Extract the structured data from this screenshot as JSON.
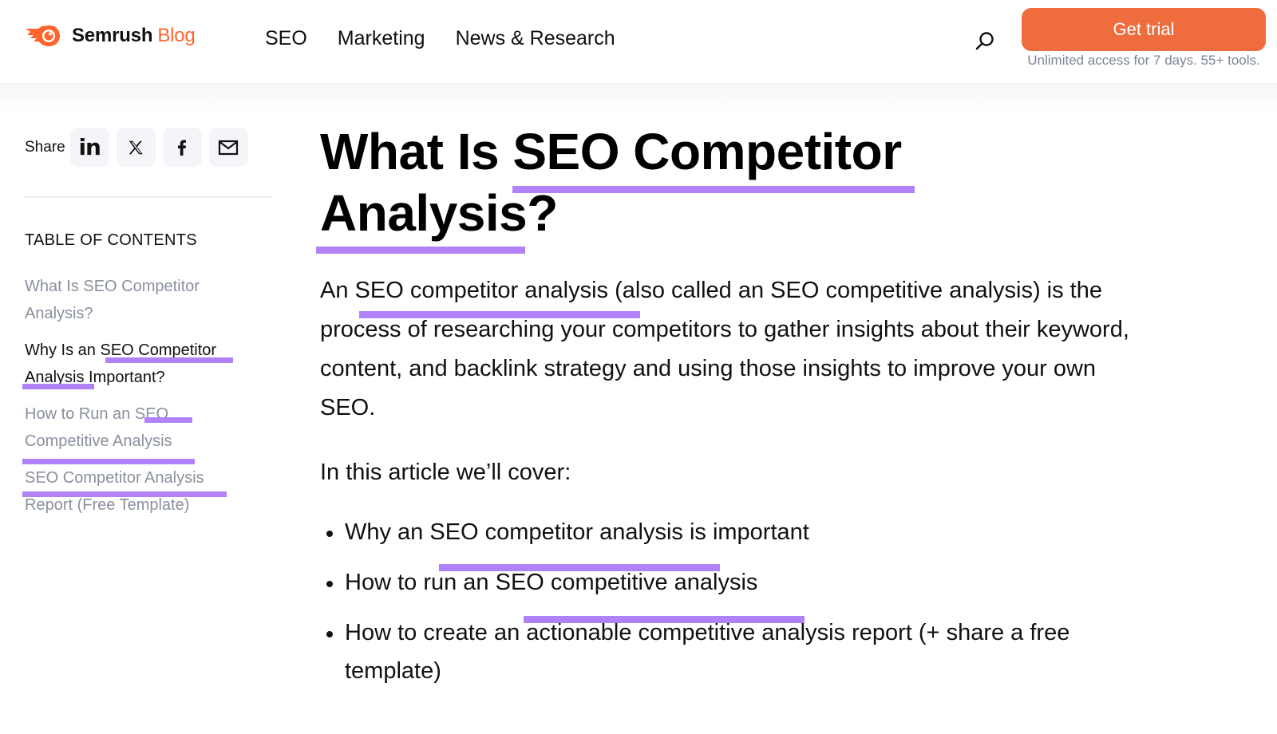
{
  "header": {
    "brand": "Semrush",
    "brand_suffix": "Blog",
    "brand_color": "#ff642d",
    "nav": [
      {
        "label": "SEO"
      },
      {
        "label": "Marketing"
      },
      {
        "label": "News & Research"
      }
    ],
    "search_icon": "search-icon",
    "cta_label": "Get trial",
    "cta_color": "#ee6c3e",
    "cta_subtext": "Unlimited access for 7 days. 55+ tools."
  },
  "sidebar": {
    "share_label": "Share",
    "share_buttons": [
      {
        "icon": "linkedin-icon"
      },
      {
        "icon": "x-icon"
      },
      {
        "icon": "facebook-icon"
      },
      {
        "icon": "email-icon"
      }
    ],
    "toc_title": "TABLE OF CONTENTS",
    "toc": [
      {
        "pre": "What Is SEO Competitor Analysis?",
        "hl": "",
        "post": "",
        "active": false
      },
      {
        "pre": "Why Is an ",
        "hl": "SEO Competitor Analysis",
        "post": " Important?",
        "active": true
      },
      {
        "pre": "How to Run an ",
        "hl": "SEO Competitive Analysis",
        "post": "",
        "active": false
      },
      {
        "pre": "",
        "hl": "SEO Competitor Analysis",
        "post": " Report (Free Template)",
        "active": false
      }
    ]
  },
  "article": {
    "title_pre": "What Is ",
    "title_hl": "SEO Competitor Analysis",
    "title_post": "?",
    "highlight_color": "#b182f7",
    "intro_pre": "An ",
    "intro_hl": "SEO competitor analysis",
    "intro_post": " (also called an SEO competitive analysis) is the process of researching your competitors to gather insights about their keyword, content, and backlink strategy and using those insights to improve your own SEO.",
    "cover_label": "In this article we’ll cover:",
    "bullets": [
      {
        "pre": "Why an ",
        "hl": "SEO competitor analysis",
        "post": " is important"
      },
      {
        "pre": "How to run an ",
        "hl": "SEO competitive analysis",
        "post": ""
      },
      {
        "pre": "How to create an actionable competitive analysis report (+ share a free template)",
        "hl": "",
        "post": ""
      }
    ]
  }
}
